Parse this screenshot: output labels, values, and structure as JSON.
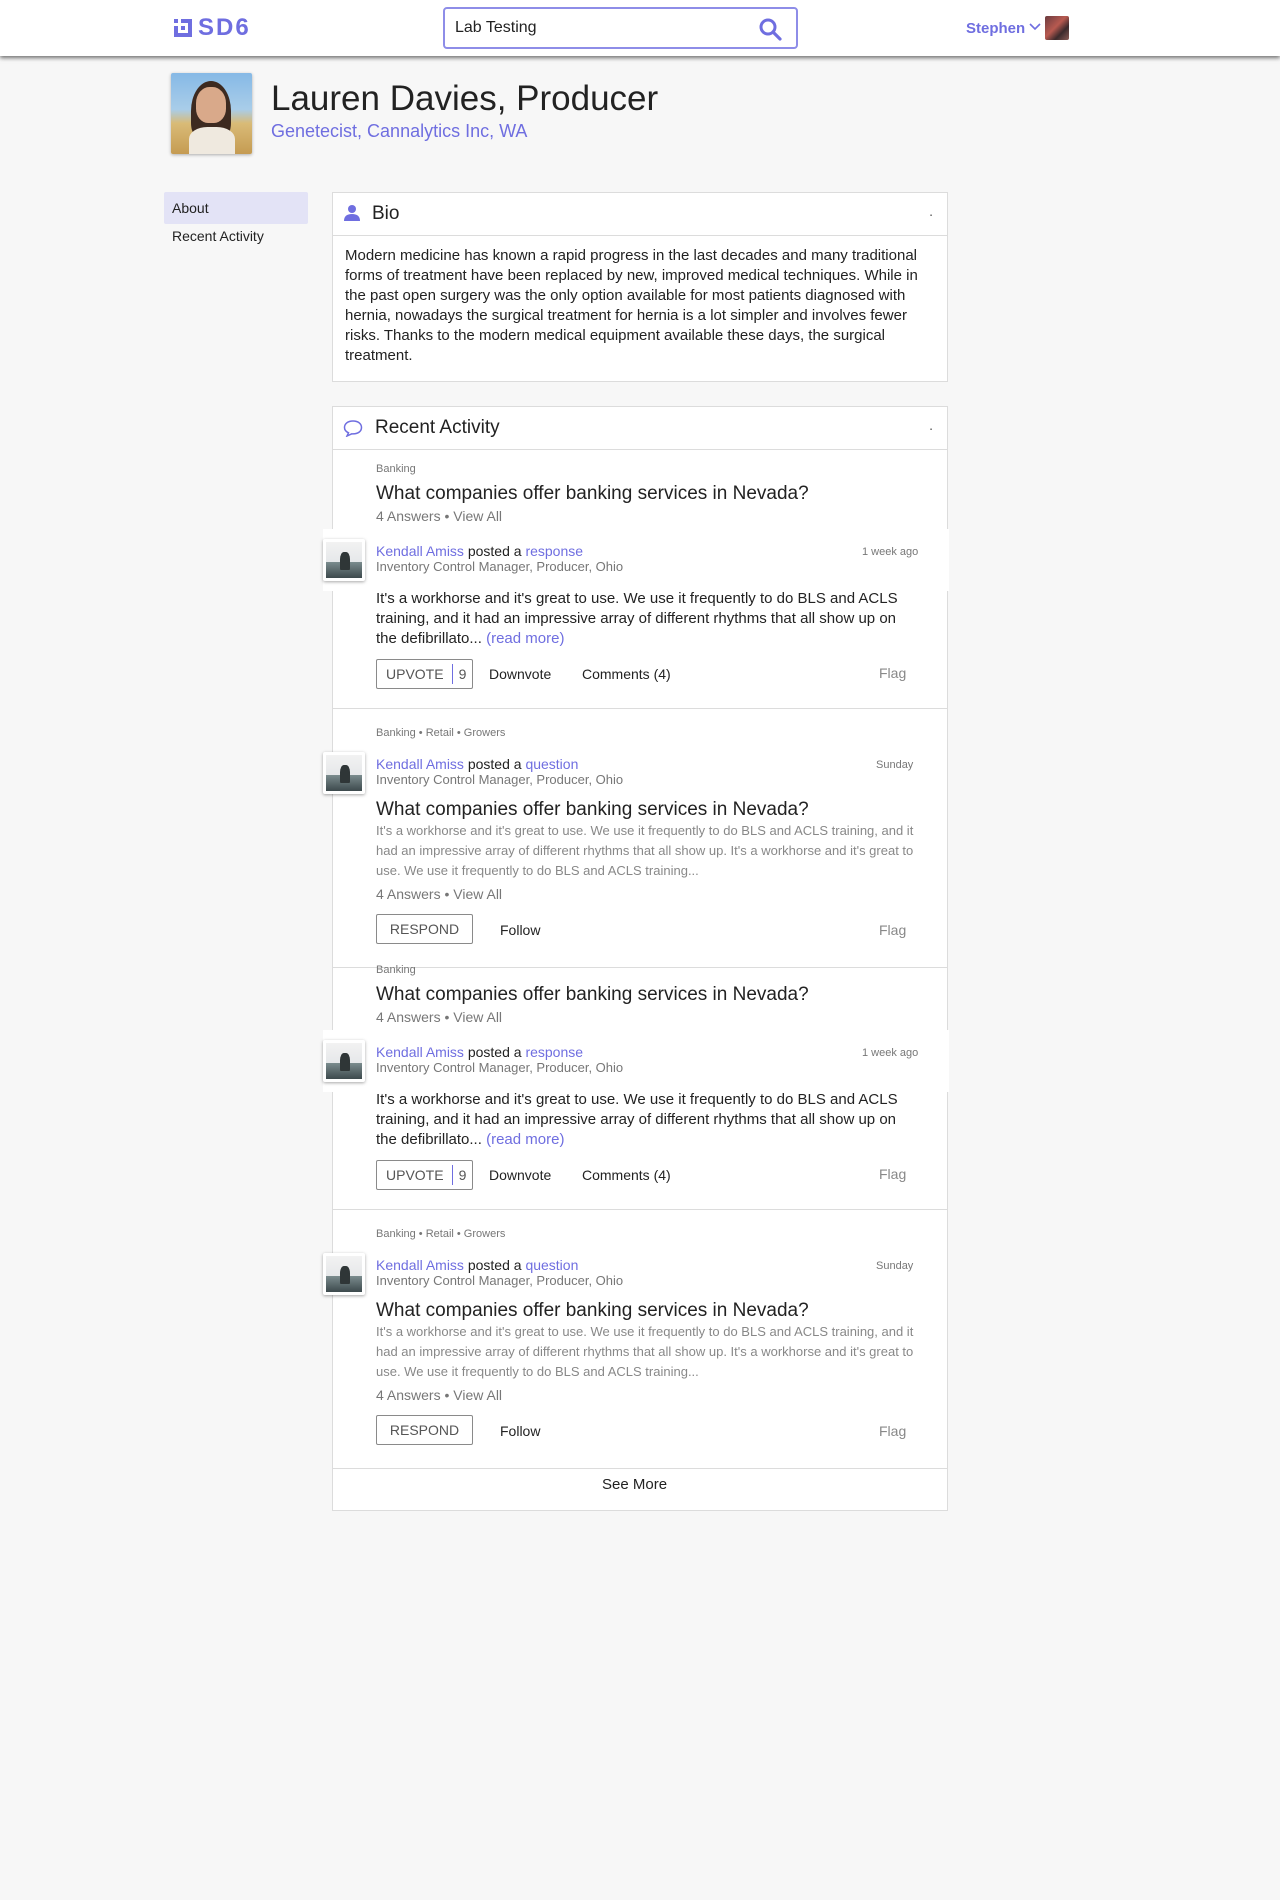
{
  "header": {
    "logo": "SD6",
    "search_value": "Lab Testing",
    "user_name": "Stephen"
  },
  "profile": {
    "name": "Lauren Davies, Producer",
    "subtitle": "Genetecist, Cannalytics Inc, WA"
  },
  "sidenav": {
    "items": [
      {
        "label": "About"
      },
      {
        "label": "Recent Activity"
      }
    ]
  },
  "bio": {
    "title": "Bio",
    "dot": ".",
    "text": "Modern medicine has known a rapid progress in the last decades and many traditional forms of treatment have been replaced by new, improved medical techniques. While in the past open surgery was the only option available for most patients diagnosed with hernia, nowadays the surgical treatment for hernia is a lot simpler and involves fewer risks. Thanks to the modern medical equipment available these days, the surgical treatment."
  },
  "activity": {
    "title": "Recent Activity",
    "dot": ".",
    "see_more": "See More",
    "response_items": [
      {
        "tag": "Banking",
        "question": "What companies offer banking services in Nevada?",
        "answers": "4 Answers • View All",
        "author": "Kendall Amiss",
        "posted": "posted a",
        "kind": "response",
        "time": "1 week ago",
        "role": "Inventory Control Manager, Producer, Ohio",
        "body": "It's a workhorse and it's great to use. We use it frequently to do BLS and ACLS training, and it had an impressive array of different rhythms that all show up on the defibrillato...",
        "read_more": "(read more)",
        "upvote": "UPVOTE",
        "votes": "9",
        "downvote": "Downvote",
        "comments": "Comments (4)",
        "flag": "Flag"
      },
      {
        "tag": "Banking",
        "question": "What companies offer banking services in Nevada?",
        "answers": "4 Answers • View All",
        "author": "Kendall Amiss",
        "posted": "posted a",
        "kind": "response",
        "time": "1 week ago",
        "role": "Inventory Control Manager, Producer, Ohio",
        "body": "It's a workhorse and it's great to use. We use it frequently to do BLS and ACLS training, and it had an impressive array of different rhythms that all show up on the defibrillato...",
        "read_more": "(read more)",
        "upvote": "UPVOTE",
        "votes": "9",
        "downvote": "Downvote",
        "comments": "Comments (4)",
        "flag": "Flag"
      }
    ],
    "question_items": [
      {
        "tags": "Banking • Retail • Growers",
        "author": "Kendall Amiss",
        "posted": "posted a",
        "kind": "question",
        "time": "Sunday",
        "role": "Inventory Control Manager, Producer, Ohio",
        "question": "What companies offer banking services in Nevada?",
        "body": "It's a workhorse and it's great to use. We use it frequently to do BLS and ACLS training, and it had an impressive array of different rhythms that all show up. It's a workhorse and it's great to use. We use it frequently to do BLS and ACLS training...",
        "answers": "4 Answers • View All",
        "respond": "RESPOND",
        "follow": "Follow",
        "flag": "Flag"
      },
      {
        "tags": "Banking • Retail • Growers",
        "author": "Kendall Amiss",
        "posted": "posted a",
        "kind": "question",
        "time": "Sunday",
        "role": "Inventory Control Manager, Producer, Ohio",
        "question": "What companies offer banking services in Nevada?",
        "body": "It's a workhorse and it's great to use. We use it frequently to do BLS and ACLS training, and it had an impressive array of different rhythms that all show up. It's a workhorse and it's great to use. We use it frequently to do BLS and ACLS training...",
        "answers": "4 Answers • View All",
        "respond": "RESPOND",
        "follow": "Follow",
        "flag": "Flag"
      }
    ]
  }
}
